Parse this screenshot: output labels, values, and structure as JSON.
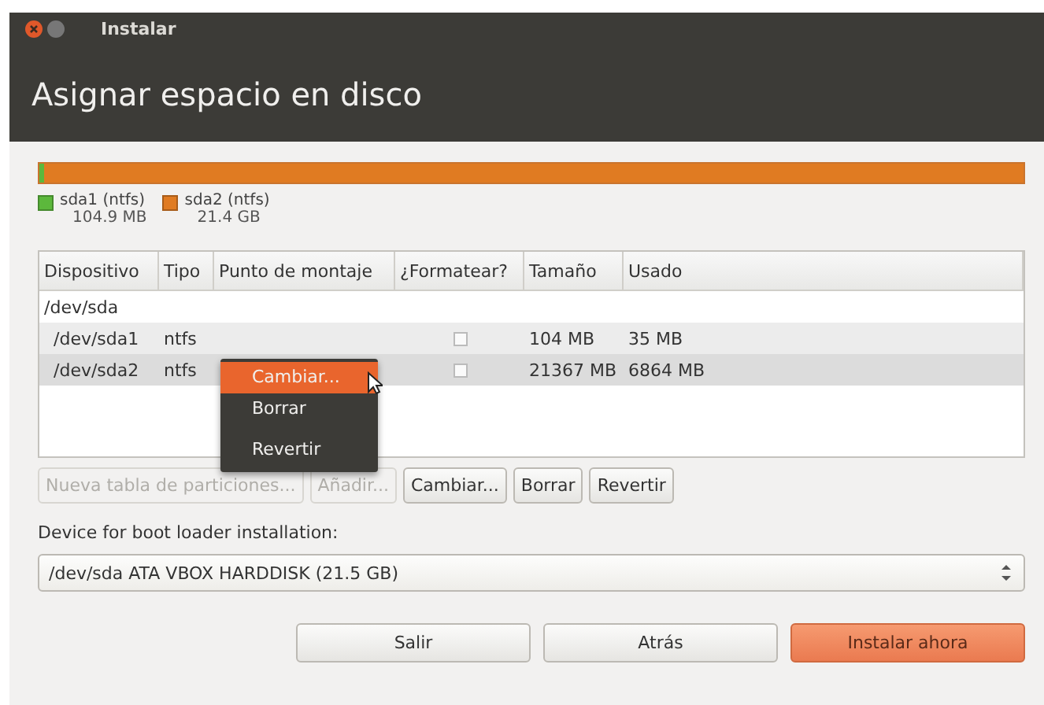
{
  "window": {
    "title": "Instalar"
  },
  "heading": "Asignar espacio en disco",
  "partitions": [
    {
      "name": "sda1 (ntfs)",
      "size": "104.9 MB",
      "color": "#5cb83c",
      "level": 0.005
    },
    {
      "name": "sda2 (ntfs)",
      "size": "21.4 GB",
      "color": "#e07b22",
      "level": 0.995
    }
  ],
  "table": {
    "columns": [
      "Dispositivo",
      "Tipo",
      "Punto de montaje",
      "¿Formatear?",
      "Tamaño",
      "Usado"
    ],
    "rows": [
      {
        "device": "/dev/sda",
        "selected": false,
        "children": [
          {
            "device": "/dev/sda1",
            "type": "ntfs",
            "format": false,
            "size": "104 MB",
            "used": "35 MB",
            "selected": false
          },
          {
            "device": "/dev/sda2",
            "type": "ntfs",
            "format": false,
            "size": "21367 MB",
            "used": "6864 MB",
            "selected": true
          }
        ]
      }
    ]
  },
  "context_menu": [
    {
      "label": "Cambiar...",
      "selected": true
    },
    {
      "label": "Borrar",
      "selected": false
    },
    {
      "label": "Revertir",
      "selected": false
    }
  ],
  "table_buttons": [
    {
      "label": "Nueva tabla de particiones...",
      "disabled": true
    },
    {
      "label": "Añadir...",
      "disabled": true
    },
    {
      "label": "Cambiar...",
      "disabled": false
    },
    {
      "label": "Borrar",
      "disabled": false
    },
    {
      "label": "Revertir",
      "disabled": false
    }
  ],
  "bootloader": {
    "label": "Device for boot loader installation:",
    "value": "/dev/sda ATA VBOX HARDDISK (21.5 GB)"
  },
  "buttons": [
    {
      "label": "Salir",
      "kind": "normal"
    },
    {
      "label": "Atrás",
      "kind": "normal"
    },
    {
      "label": "Instalar ahora",
      "kind": "primary"
    }
  ]
}
